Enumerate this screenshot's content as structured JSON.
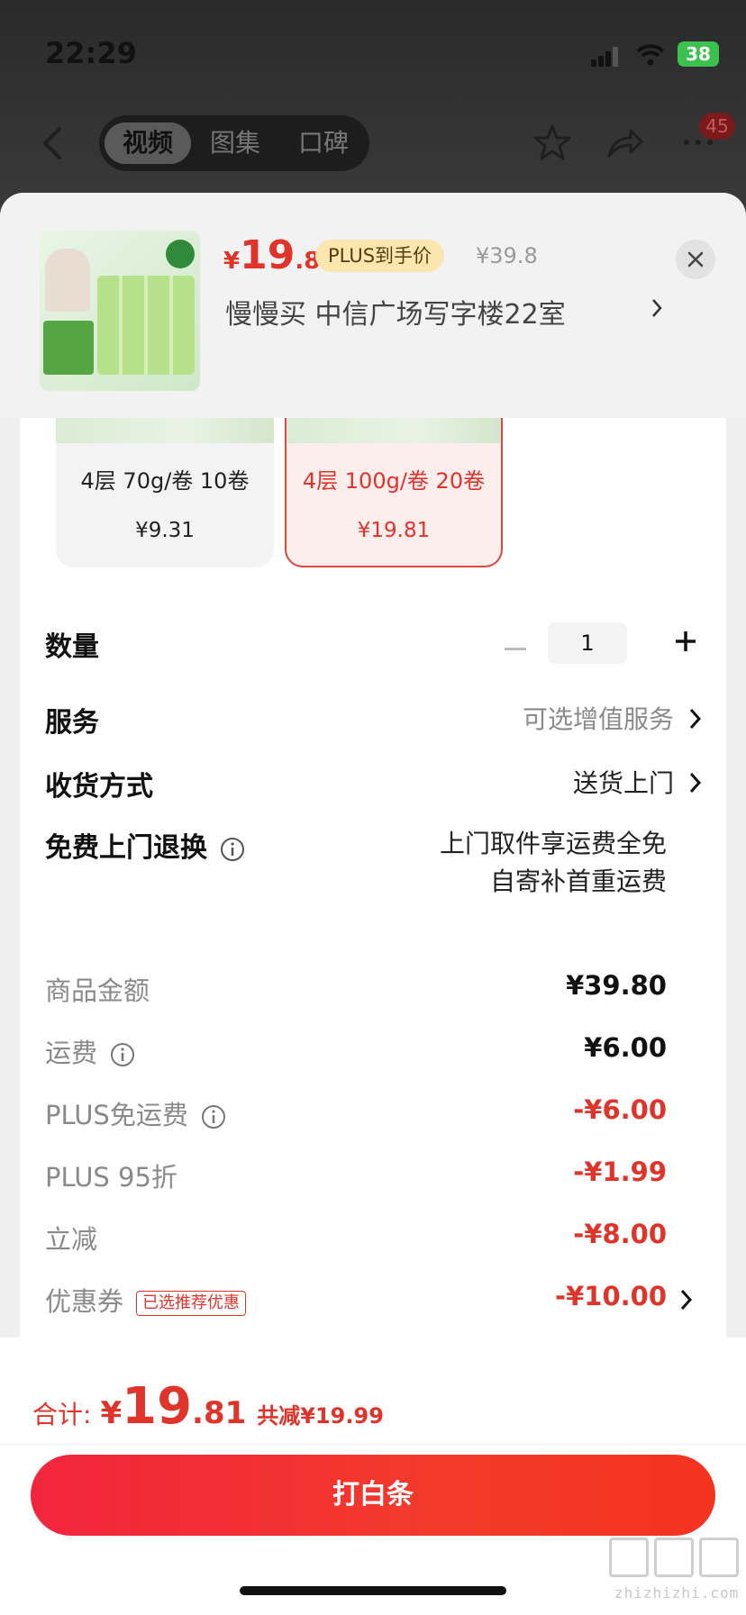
{
  "status_bar": {
    "time": "22:29",
    "battery": "38"
  },
  "nav": {
    "tabs": [
      {
        "label": "视频"
      },
      {
        "label": "图集"
      },
      {
        "label": "口碑"
      }
    ],
    "badge_count": "45"
  },
  "product": {
    "price_currency": "¥",
    "price_integer": "19",
    "price_decimal": ".81",
    "plus_tag": "PLUS到手价",
    "original_price": "¥39.8",
    "address": "慢慢买  中信广场写字楼22室"
  },
  "variants": [
    {
      "label": "4层 70g/卷 10卷",
      "price": "¥9.31",
      "selected": false
    },
    {
      "label": "4层 100g/卷 20卷",
      "price": "¥19.81",
      "selected": true
    }
  ],
  "options": {
    "quantity": {
      "label": "数量",
      "value": "1"
    },
    "service": {
      "label": "服务",
      "value": "可选增值服务"
    },
    "delivery": {
      "label": "收货方式",
      "value": "送货上门"
    },
    "returns": {
      "label": "免费上门退换",
      "line1": "上门取件享运费全免",
      "line2": "自寄补首重运费"
    }
  },
  "price_breakdown": {
    "goods": {
      "label": "商品金额",
      "value": "¥39.80"
    },
    "shipping": {
      "label": "运费",
      "value": "¥6.00"
    },
    "plus_free_shipping": {
      "label": "PLUS免运费",
      "value": "-¥6.00"
    },
    "plus_discount": {
      "label": "PLUS 95折",
      "value": "-¥1.99"
    },
    "instant_off": {
      "label": "立减",
      "value": "-¥8.00"
    },
    "coupon": {
      "label": "优惠券",
      "tag": "已选推荐优惠",
      "value": "-¥10.00"
    }
  },
  "footer": {
    "total_label": "合计:",
    "total_currency": "¥",
    "total_integer": "19",
    "total_decimal": ".81",
    "total_saved": "共减¥19.99",
    "pay_button": "打白条",
    "watermark": "zhizhizhi.com"
  },
  "colors": {
    "accent_red": "#e0342b",
    "plus_gold": "#fbe6b0"
  },
  "icons": [
    "back-icon",
    "star-icon",
    "share-icon",
    "more-icon",
    "close-icon",
    "chevron-right-icon",
    "info-icon",
    "plus-icon",
    "minus-icon"
  ]
}
